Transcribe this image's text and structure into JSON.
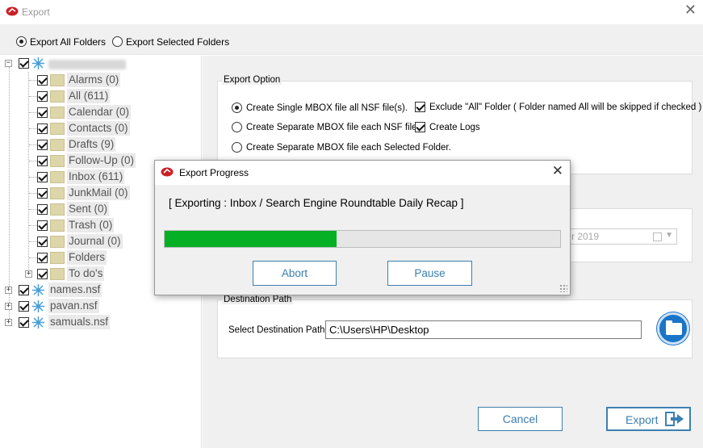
{
  "window": {
    "title": "Export",
    "logo_icon": "app-logo-icon",
    "close_glyph": "✕"
  },
  "scope": {
    "options": [
      {
        "label": "Export All Folders",
        "selected": true
      },
      {
        "label": "Export Selected Folders",
        "selected": false
      }
    ]
  },
  "tree": {
    "root_label_blurred": true,
    "folders": [
      {
        "label": "Alarms (0)",
        "checked": true
      },
      {
        "label": "All (611)",
        "checked": true
      },
      {
        "label": "Calendar (0)",
        "checked": true
      },
      {
        "label": "Contacts (0)",
        "checked": true
      },
      {
        "label": "Drafts (9)",
        "checked": true
      },
      {
        "label": "Follow-Up (0)",
        "checked": true
      },
      {
        "label": "Inbox (611)",
        "checked": true
      },
      {
        "label": "JunkMail (0)",
        "checked": true
      },
      {
        "label": "Sent (0)",
        "checked": true
      },
      {
        "label": "Trash (0)",
        "checked": true
      },
      {
        "label": "Journal (0)",
        "checked": true
      },
      {
        "label": "Folders",
        "checked": true
      },
      {
        "label": "To do's",
        "checked": true
      }
    ],
    "files": [
      {
        "label": "names.nsf",
        "checked": true
      },
      {
        "label": "pavan.nsf",
        "checked": true
      },
      {
        "label": "samuals.nsf",
        "checked": true
      }
    ]
  },
  "export_option": {
    "legend": "Export Option",
    "radios": [
      {
        "label": "Create Single MBOX file all NSF file(s).",
        "selected": true
      },
      {
        "label": "Create Separate MBOX file each NSF file.",
        "selected": false
      },
      {
        "label": "Create Separate MBOX file each Selected Folder.",
        "selected": false
      }
    ],
    "checks": [
      {
        "label": "Exclude \"All\" Folder ( Folder named All will be skipped if checked )",
        "checked": true
      },
      {
        "label": "Create Logs",
        "checked": true
      }
    ]
  },
  "date_filter": {
    "value_partial": "r 2019"
  },
  "destination": {
    "legend": "Destination Path",
    "label": "Select Destination Path",
    "value": "C:\\Users\\HP\\Desktop",
    "browse_icon": "folder-open-icon"
  },
  "actions": {
    "cancel_label": "Cancel",
    "export_label": "Export",
    "export_icon": "exit-arrow-icon"
  },
  "progress_dialog": {
    "title": "Export Progress",
    "status": "[ Exporting : Inbox / Search Engine Roundtable Daily Recap ]",
    "progress_fraction": 0.435,
    "progress_color": "#06b025",
    "abort_label": "Abort",
    "pause_label": "Pause",
    "close_glyph": "✕"
  },
  "colors": {
    "accent": "#3c7fb1",
    "brand_red": "#cc2027"
  }
}
